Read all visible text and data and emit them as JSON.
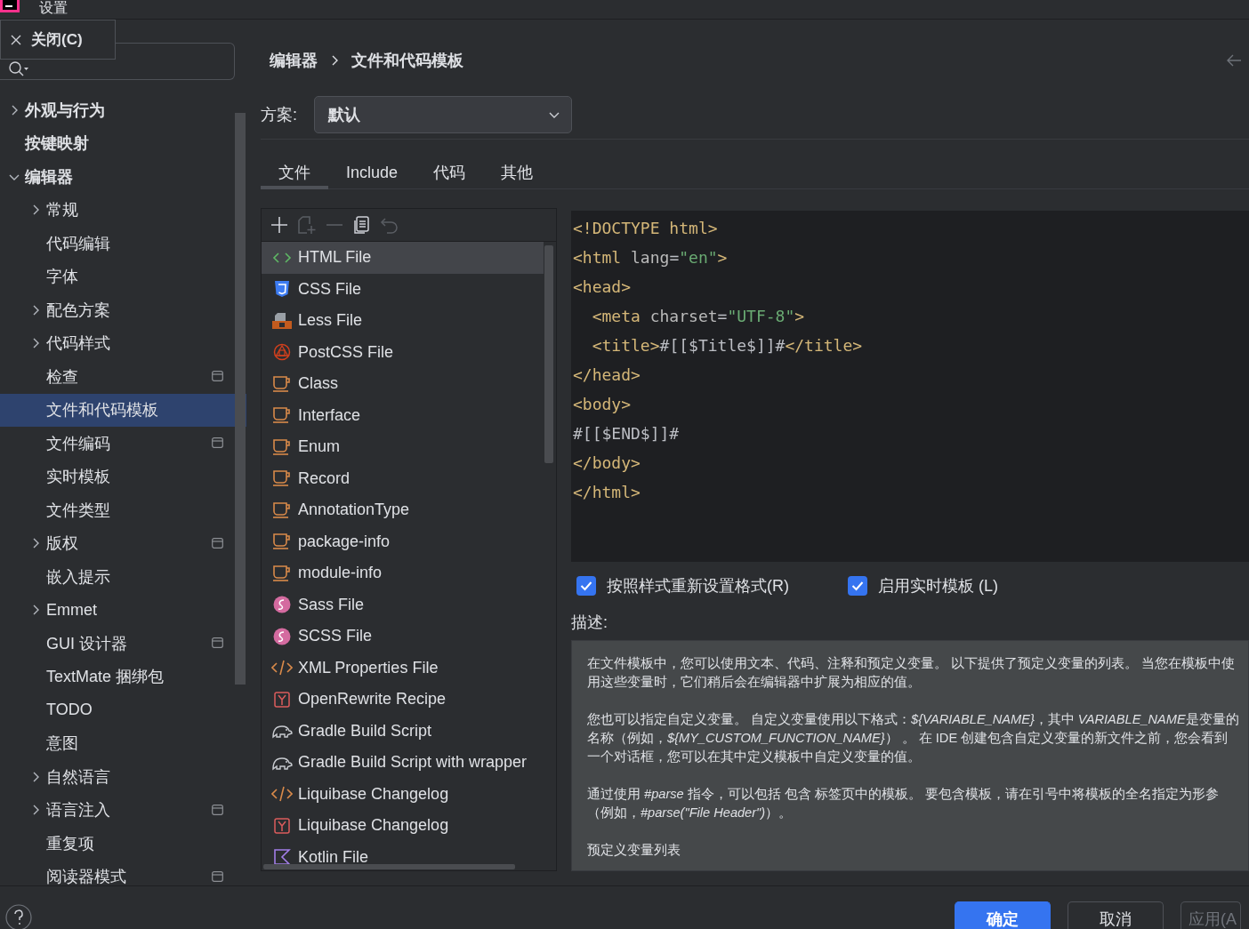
{
  "window": {
    "title": "设置"
  },
  "close_popup": {
    "label": "关闭(C)"
  },
  "sidebar": {
    "items": [
      {
        "label": "外观与行为",
        "selected": false,
        "expanded": false,
        "project": false
      },
      {
        "label": "按键映射",
        "selected": false,
        "project": false
      },
      {
        "label": "编辑器",
        "selected": false,
        "expanded": true,
        "project": false,
        "children": [
          {
            "label": "常规",
            "selected": false,
            "expanded": false,
            "project": false
          },
          {
            "label": "代码编辑",
            "selected": false,
            "project": false
          },
          {
            "label": "字体",
            "selected": false,
            "project": false
          },
          {
            "label": "配色方案",
            "selected": false,
            "expanded": false,
            "project": false
          },
          {
            "label": "代码样式",
            "selected": false,
            "expanded": false,
            "project": false
          },
          {
            "label": "检查",
            "selected": false,
            "project": true
          },
          {
            "label": "文件和代码模板",
            "selected": true,
            "project": false
          },
          {
            "label": "文件编码",
            "selected": false,
            "project": true
          },
          {
            "label": "实时模板",
            "selected": false,
            "project": false
          },
          {
            "label": "文件类型",
            "selected": false,
            "project": false
          },
          {
            "label": "版权",
            "selected": false,
            "expanded": false,
            "project": true
          },
          {
            "label": "嵌入提示",
            "selected": false,
            "project": false
          },
          {
            "label": "Emmet",
            "selected": false,
            "expanded": false,
            "project": false
          },
          {
            "label": "GUI 设计器",
            "selected": false,
            "project": true
          },
          {
            "label": "TextMate 捆绑包",
            "selected": false,
            "project": false
          },
          {
            "label": "TODO",
            "selected": false,
            "project": false
          },
          {
            "label": "意图",
            "selected": false,
            "project": false
          },
          {
            "label": "自然语言",
            "selected": false,
            "expanded": false,
            "project": false
          },
          {
            "label": "语言注入",
            "selected": false,
            "expanded": false,
            "project": true
          },
          {
            "label": "重复项",
            "selected": false,
            "project": false
          },
          {
            "label": "阅读器模式",
            "selected": false,
            "project": true
          }
        ]
      }
    ]
  },
  "breadcrumb": [
    "编辑器",
    "文件和代码模板"
  ],
  "scheme": {
    "label": "方案:",
    "value": "默认"
  },
  "tabs": [
    {
      "label": "文件",
      "selected": true
    },
    {
      "label": "Include",
      "selected": false
    },
    {
      "label": "代码",
      "selected": false
    },
    {
      "label": "其他",
      "selected": false
    }
  ],
  "toolbar": [
    {
      "kind": "add",
      "disabled": false
    },
    {
      "kind": "add-copy",
      "disabled": true
    },
    {
      "kind": "remove",
      "disabled": true
    },
    {
      "kind": "copy",
      "disabled": false
    },
    {
      "kind": "reset",
      "disabled": true
    }
  ],
  "templates": [
    {
      "label": "HTML File",
      "kind": "html",
      "selected": true
    },
    {
      "label": "CSS File",
      "kind": "css",
      "selected": false
    },
    {
      "label": "Less File",
      "kind": "less",
      "selected": false
    },
    {
      "label": "PostCSS File",
      "kind": "postcss",
      "selected": false
    },
    {
      "label": "Class",
      "kind": "java",
      "selected": false
    },
    {
      "label": "Interface",
      "kind": "java",
      "selected": false
    },
    {
      "label": "Enum",
      "kind": "java",
      "selected": false
    },
    {
      "label": "Record",
      "kind": "java",
      "selected": false
    },
    {
      "label": "AnnotationType",
      "kind": "java",
      "selected": false
    },
    {
      "label": "package-info",
      "kind": "java",
      "selected": false
    },
    {
      "label": "module-info",
      "kind": "java",
      "selected": false
    },
    {
      "label": "Sass File",
      "kind": "sass",
      "selected": false
    },
    {
      "label": "SCSS File",
      "kind": "sass",
      "selected": false
    },
    {
      "label": "XML Properties File",
      "kind": "xml",
      "selected": false
    },
    {
      "label": "OpenRewrite Recipe",
      "kind": "yaml",
      "selected": false
    },
    {
      "label": "Gradle Build Script",
      "kind": "gradle",
      "selected": false
    },
    {
      "label": "Gradle Build Script with wrapper",
      "kind": "gradle",
      "selected": false
    },
    {
      "label": "Liquibase Changelog",
      "kind": "xml",
      "selected": false
    },
    {
      "label": "Liquibase Changelog",
      "kind": "yaml",
      "selected": false
    },
    {
      "label": "Kotlin File",
      "kind": "kotlin",
      "selected": false
    }
  ],
  "code": [
    [
      {
        "kind": "tag",
        "text": "<!DOCTYPE html>"
      }
    ],
    [
      {
        "kind": "tag",
        "text": "<html"
      },
      {
        "kind": "attr",
        "text": " lang"
      },
      {
        "kind": "text",
        "text": "="
      },
      {
        "kind": "value",
        "text": "\"en\""
      },
      {
        "kind": "tag",
        "text": ">"
      }
    ],
    [
      {
        "kind": "tag",
        "text": "<head>"
      }
    ],
    [
      {
        "kind": "tag",
        "text": "  <meta"
      },
      {
        "kind": "attr",
        "text": " charset"
      },
      {
        "kind": "text",
        "text": "="
      },
      {
        "kind": "value",
        "text": "\"UTF-8\""
      },
      {
        "kind": "tag",
        "text": ">"
      }
    ],
    [
      {
        "kind": "tag",
        "text": "  <title>"
      },
      {
        "kind": "text",
        "text": "#[[$Title$]]#"
      },
      {
        "kind": "tag",
        "text": "</title>"
      }
    ],
    [
      {
        "kind": "tag",
        "text": "</head>"
      }
    ],
    [
      {
        "kind": "tag",
        "text": "<body>"
      }
    ],
    [
      {
        "kind": "text",
        "text": "#[[$END$]]#"
      }
    ],
    [
      {
        "kind": "tag",
        "text": "</body>"
      }
    ],
    [
      {
        "kind": "tag",
        "text": "</html>"
      }
    ]
  ],
  "options": [
    {
      "label": "按照样式重新设置格式(R)",
      "checked": true
    },
    {
      "label": "启用实时模板 (L)",
      "checked": true
    }
  ],
  "description": {
    "label": "描述:",
    "paragraphs": [
      [
        {
          "text": "在文件模板中，您可以使用文本、代码、注释和预定义变量。 以下提供了预定义变量的列表。 当您在模板中使用这些变量时，它们稍后会在编辑器中扩展为相应的值。",
          "italic": false
        }
      ],
      [
        {
          "text": "您也可以指定自定义变量。 自定义变量使用以下格式：",
          "italic": false
        },
        {
          "text": "${VARIABLE_NAME}",
          "italic": true
        },
        {
          "text": "，其中 ",
          "italic": false
        },
        {
          "text": "VARIABLE_NAME",
          "italic": true
        },
        {
          "text": "是变量的名称（例如，",
          "italic": false
        },
        {
          "text": "${MY_CUSTOM_FUNCTION_NAME}",
          "italic": true
        },
        {
          "text": "） 。 在 IDE 创建包含自定义变量的新文件之前，您会看到一个对话框，您可以在其中定义模板中自定义变量的值。",
          "italic": false
        }
      ],
      [
        {
          "text": "通过使用 ",
          "italic": false
        },
        {
          "text": "#parse",
          "italic": true
        },
        {
          "text": " 指令，可以包括 包含 标签页中的模板。 要包含模板，请在引号中将模板的全名指定为形参（例如，",
          "italic": false
        },
        {
          "text": "#parse(\"File Header\")",
          "italic": true
        },
        {
          "text": "）。",
          "italic": false
        }
      ],
      [
        {
          "text": "预定义变量列表",
          "italic": false
        }
      ]
    ]
  },
  "buttons": [
    {
      "label": "确定",
      "kind": "primary",
      "disabled": false
    },
    {
      "label": "取消",
      "kind": "default",
      "disabled": false
    },
    {
      "label": "应用(A",
      "kind": "default",
      "disabled": true
    }
  ]
}
